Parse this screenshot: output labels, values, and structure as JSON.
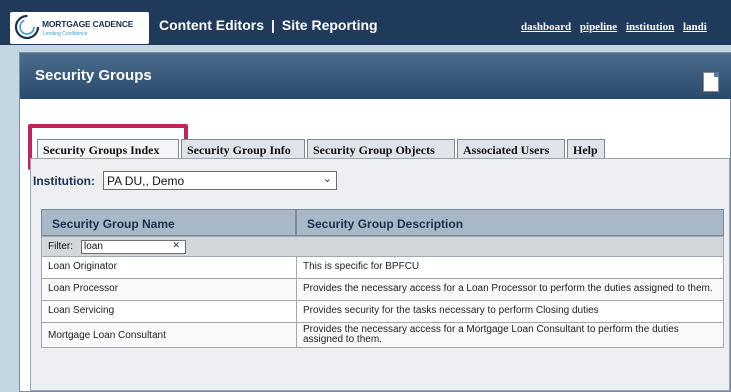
{
  "header": {
    "logo_name": "MORTGAGE CADENCE",
    "logo_tagline": "Lending Confidence",
    "nav_left": "Content Editors",
    "nav_separator": "|",
    "nav_right": "Site Reporting",
    "links": [
      "dashboard",
      "pipeline",
      "institution",
      "landi"
    ],
    "colors": {
      "topbar": "#1f3a5a",
      "highlight": "#c1245a"
    }
  },
  "page": {
    "title": "Security Groups",
    "icon": "document-icon"
  },
  "tabs": [
    {
      "label": "Security Groups Index",
      "active": true
    },
    {
      "label": "Security Group Info",
      "active": false
    },
    {
      "label": "Security Group Objects",
      "active": false
    },
    {
      "label": "Associated Users",
      "active": false
    },
    {
      "label": "Help",
      "active": false
    }
  ],
  "institution": {
    "label": "Institution:",
    "value": "PA DU,, Demo"
  },
  "table": {
    "columns": [
      "Security Group Name",
      "Security Group Description"
    ],
    "filter_label": "Filter:",
    "filter_value": "loan",
    "rows": [
      {
        "name": "Loan Originator",
        "description": "This is specific for BPFCU"
      },
      {
        "name": "Loan Processor",
        "description": "Provides the necessary access for a Loan Processor to perform the duties assigned to them."
      },
      {
        "name": "Loan Servicing",
        "description": "Provides security for the tasks necessary to perform Closing duties"
      },
      {
        "name": "Mortgage Loan Consultant",
        "description": "Provides the necessary access for a Mortgage Loan Consultant to perform the duties assigned to them."
      }
    ]
  }
}
